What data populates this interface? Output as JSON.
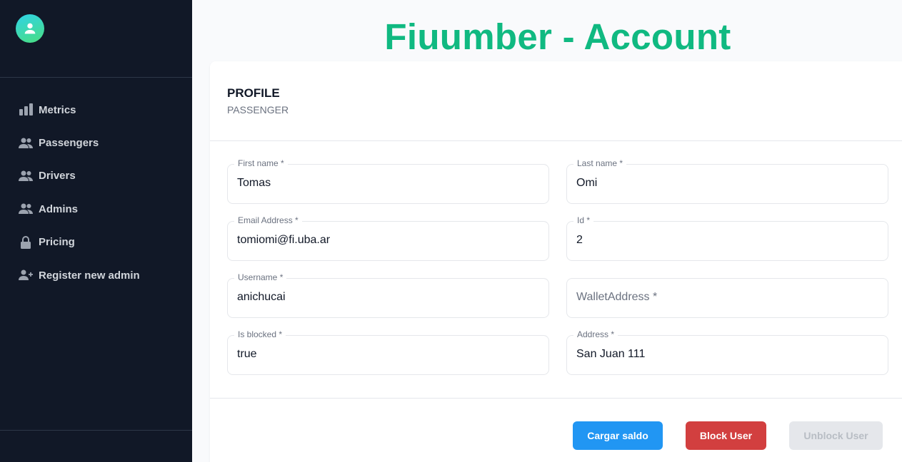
{
  "page": {
    "title": "Fiuumber - Account"
  },
  "sidebar": {
    "items": [
      {
        "label": "Metrics",
        "icon": "bar-chart-icon"
      },
      {
        "label": "Passengers",
        "icon": "users-icon"
      },
      {
        "label": "Drivers",
        "icon": "users-icon"
      },
      {
        "label": "Admins",
        "icon": "users-icon"
      },
      {
        "label": "Pricing",
        "icon": "lock-icon"
      },
      {
        "label": "Register new admin",
        "icon": "user-add-icon"
      }
    ]
  },
  "profile": {
    "title": "PROFILE",
    "subtitle": "PASSENGER",
    "fields": {
      "first_name": {
        "label": "First name *",
        "value": "Tomas"
      },
      "last_name": {
        "label": "Last name *",
        "value": "Omi"
      },
      "email": {
        "label": "Email Address *",
        "value": "tomiomi@fi.uba.ar"
      },
      "id": {
        "label": "Id *",
        "value": "2"
      },
      "username": {
        "label": "Username *",
        "value": "anichucai"
      },
      "wallet": {
        "placeholder": "WalletAddress *",
        "value": ""
      },
      "is_blocked": {
        "label": "Is blocked *",
        "value": "true"
      },
      "address": {
        "label": "Address *",
        "value": "San Juan 111"
      }
    }
  },
  "actions": {
    "load_balance": "Cargar saldo",
    "block": "Block User",
    "unblock": "Unblock User"
  },
  "colors": {
    "sidebar_bg": "#111827",
    "title_green": "#10b981",
    "button_blue": "#2196f3",
    "button_red": "#d23f3f",
    "button_disabled": "#e5e7eb"
  }
}
